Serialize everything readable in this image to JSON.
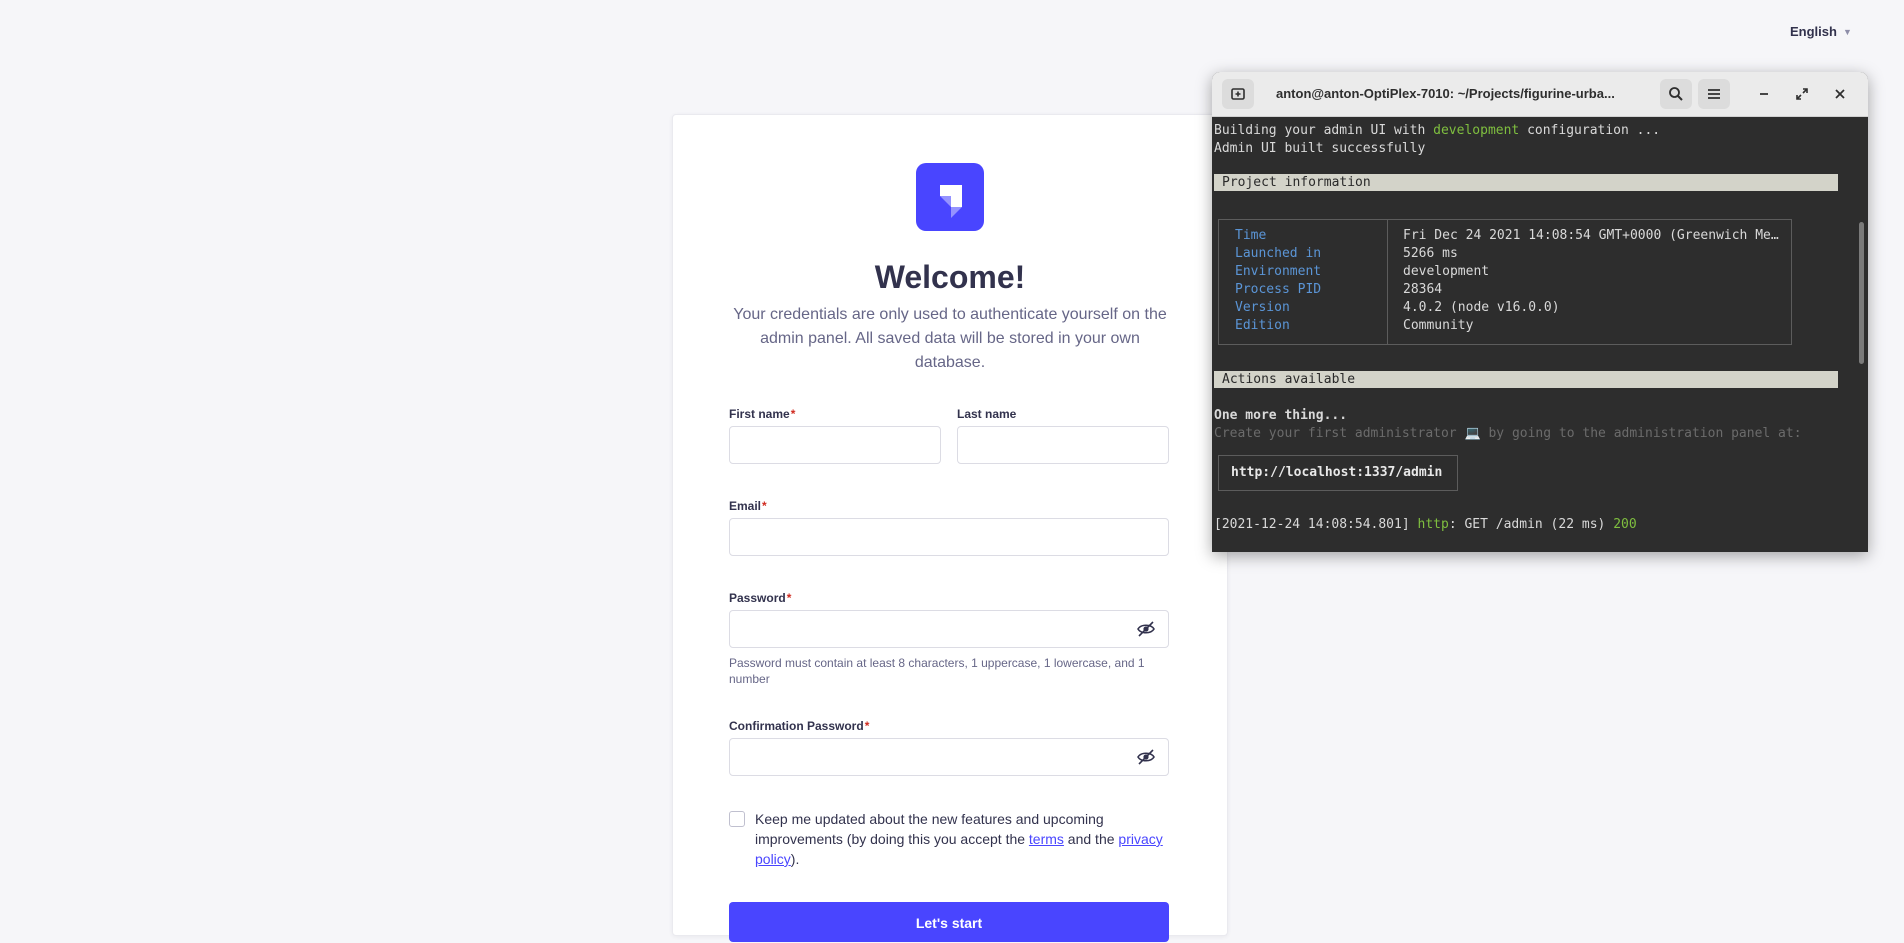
{
  "language": {
    "selected": "English"
  },
  "card": {
    "title": "Welcome!",
    "subtitle": "Your credentials are only used to authenticate yourself on the admin panel. All saved data will be stored in your own database.",
    "first_name_label": "First name",
    "last_name_label": "Last name",
    "email_label": "Email",
    "password_label": "Password",
    "password_hint": "Password must contain at least 8 characters, 1 uppercase, 1 lowercase, and 1 number",
    "confirm_password_label": "Confirmation Password",
    "required_mark": "*",
    "consent_text_1": "Keep me updated about the new features and upcoming improvements (by doing this you accept the ",
    "terms_link": "terms",
    "consent_text_2": " and the ",
    "privacy_link": "privacy policy",
    "consent_text_3": ").",
    "submit_label": "Let's start",
    "colors": {
      "brand": "#4945ff",
      "required": "#d02b20"
    }
  },
  "terminal": {
    "title": "anton@anton-OptiPlex-7010: ~/Projects/figurine-urba...",
    "lines": {
      "building_prefix": "Building your admin UI with ",
      "building_env": "development",
      "building_suffix": " configuration ...",
      "built": "Admin UI built successfully",
      "one_more": "One more thing...",
      "create_admin": "Create your first administrator 💻 by going to the administration panel at:",
      "log_prefix": "[2021-12-24 14:08:54.801] ",
      "log_http": "http",
      "log_middle": ": GET /admin (22 ms) ",
      "log_status": "200"
    },
    "project_header": "Project information",
    "actions_header": "Actions available",
    "project_info": [
      {
        "key": "Time",
        "value": "Fri Dec 24 2021 14:08:54 GMT+0000 (Greenwich Me…"
      },
      {
        "key": "Launched in",
        "value": "5266 ms"
      },
      {
        "key": "Environment",
        "value": "development"
      },
      {
        "key": "Process PID",
        "value": "28364"
      },
      {
        "key": "Version",
        "value": "4.0.2 (node v16.0.0)"
      },
      {
        "key": "Edition",
        "value": "Community"
      }
    ],
    "admin_url": "http://localhost:1337/admin"
  }
}
